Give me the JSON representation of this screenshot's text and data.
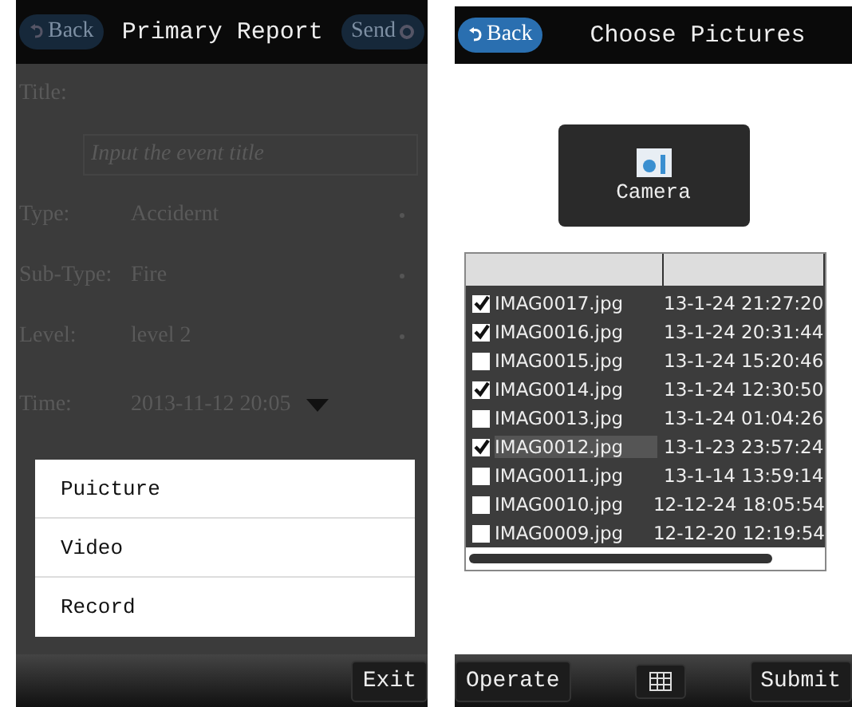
{
  "report_screen": {
    "header": {
      "back": "Back",
      "title": "Primary Report",
      "send": "Send"
    },
    "fields": [
      {
        "kind": "label",
        "label": "Title:"
      },
      {
        "kind": "input",
        "placeholder": "Input the event title"
      },
      {
        "kind": "select",
        "label": "Type:",
        "value": "Accidernt"
      },
      {
        "kind": "select",
        "label": "Sub-Type:",
        "value": "Fire"
      },
      {
        "kind": "select",
        "label": "Level:",
        "value": "level 2"
      },
      {
        "kind": "time",
        "label": "Time:",
        "value": "2013-11-12 20:05"
      }
    ],
    "popup": [
      "Puicture",
      "Video",
      "Record"
    ],
    "exit": "Exit"
  },
  "pictures_screen": {
    "header": {
      "back": "Back",
      "title": "Choose Pictures"
    },
    "camera": "Camera",
    "files": [
      {
        "name": "IMAG0017.jpg",
        "date": "13-1-24 21:27:20",
        "checked": true
      },
      {
        "name": "IMAG0016.jpg",
        "date": "13-1-24 20:31:44",
        "checked": true
      },
      {
        "name": "IMAG0015.jpg",
        "date": "13-1-24 15:20:46",
        "checked": false
      },
      {
        "name": "IMAG0014.jpg",
        "date": "13-1-24 12:30:50",
        "checked": true
      },
      {
        "name": "IMAG0013.jpg",
        "date": "13-1-24 01:04:26",
        "checked": false
      },
      {
        "name": "IMAG0012.jpg",
        "date": "13-1-23 23:57:24",
        "checked": true
      },
      {
        "name": "IMAG0011.jpg",
        "date": "13-1-14 13:59:14",
        "checked": false
      },
      {
        "name": "IMAG0010.jpg",
        "date": "12-12-24 18:05:54",
        "checked": false
      },
      {
        "name": "IMAG0009.jpg",
        "date": "12-12-20 12:19:54",
        "checked": false
      }
    ],
    "operate": "Operate",
    "submit": "Submit"
  }
}
